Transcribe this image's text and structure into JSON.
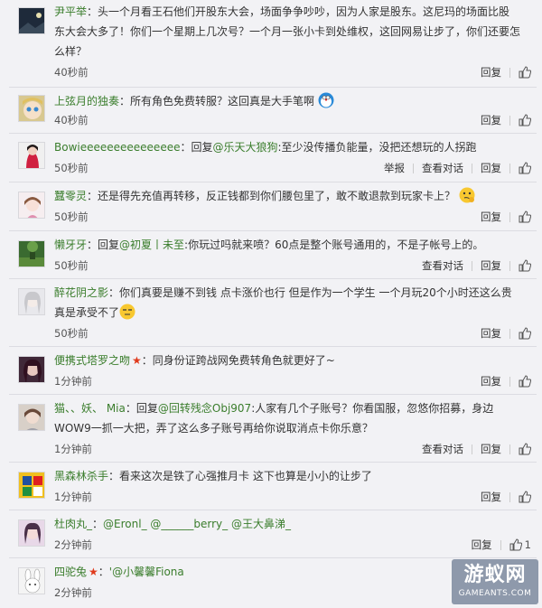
{
  "comments": [
    {
      "user": "尹平举",
      "parts": [
        "：头一个月看王石他们开股东大会，场面争争吵吵，因为人家是股东。这尼玛的场面比股东大会大多了！你们一个星期上几次号？一个月一张小卡到处维权，这回网易让步了，你们还要怎么样？"
      ],
      "time": "40秒前",
      "actions": [
        "回复"
      ]
    },
    {
      "user": "上弦月的独奏",
      "parts": [
        "：所有角色免费转服？这回真是大手笔啊"
      ],
      "time": "40秒前",
      "actions": [
        "回复"
      ]
    },
    {
      "user": "Bowieeeeeeeeeeeeeee",
      "pre": "：回复",
      "mention": "@乐天大狼狗",
      "post": ":至少没传播负能量，没把还想玩的人拐跑",
      "time": "50秒前",
      "actions": [
        "举报",
        "查看对话",
        "回复"
      ]
    },
    {
      "user": "蠶零灵",
      "parts": [
        "：还是得先充值再转移，反正钱都到你们腰包里了，敢不敢退款到玩家卡上？"
      ],
      "time": "50秒前",
      "actions": [
        "回复"
      ]
    },
    {
      "user": "懒牙牙",
      "pre": "：回复",
      "mention": "@初夏丨未至",
      "post": ":你玩过吗就来喷？60点是整个账号通用的，不是子帐号上的。",
      "time": "50秒前",
      "actions": [
        "查看对话",
        "回复"
      ]
    },
    {
      "user": "醉花阴之影",
      "parts": [
        "：你们真要是赚不到钱 点卡涨价也行 但是作为一个学生 一个月玩20个小时还这么贵真是承受不了"
      ],
      "time": "50秒前",
      "actions": [
        "回复"
      ]
    },
    {
      "user": "便携式塔罗之吻",
      "star": "★",
      "parts": [
        "：同身份证跨战网免费转角色就更好了~"
      ],
      "time": "1分钟前",
      "actions": [
        "回复"
      ]
    },
    {
      "user": "猫、、妖、 Mia",
      "pre": "：回复",
      "mention": "@回转残念Obj907",
      "post": ":人家有几个子账号？你看国服，忽悠你招募，身边WOW9一抓一大把，弄了这么多子账号再给你说取消点卡你乐意？",
      "time": "1分钟前",
      "actions": [
        "查看对话",
        "回复"
      ]
    },
    {
      "user": "黑森林杀手",
      "parts": [
        "：看来这次是铁了心强推月卡 这下也算是小小的让步了"
      ],
      "time": "1分钟前",
      "actions": [
        "回复"
      ]
    },
    {
      "user": "杜肉丸_",
      "pre": "：",
      "mention": "@Eronl_ @______berry_ @王大鼻涕_",
      "post": "",
      "time": "2分钟前",
      "actions": [
        "回复"
      ],
      "likes": "1"
    },
    {
      "user": "四驼兔",
      "star": "★",
      "pre": "：",
      "mention": "'@小馨馨Fiona",
      "post": "",
      "time": "2分钟前",
      "actions": []
    }
  ],
  "watermark": {
    "title": "游蚁网",
    "sub": "GAMEANTS.COM"
  },
  "icons": {
    "like": "thumbs-up-icon"
  },
  "colors": {
    "username": "#3a7d2c",
    "star": "#e03a1c",
    "background": "#f2f2f5"
  }
}
